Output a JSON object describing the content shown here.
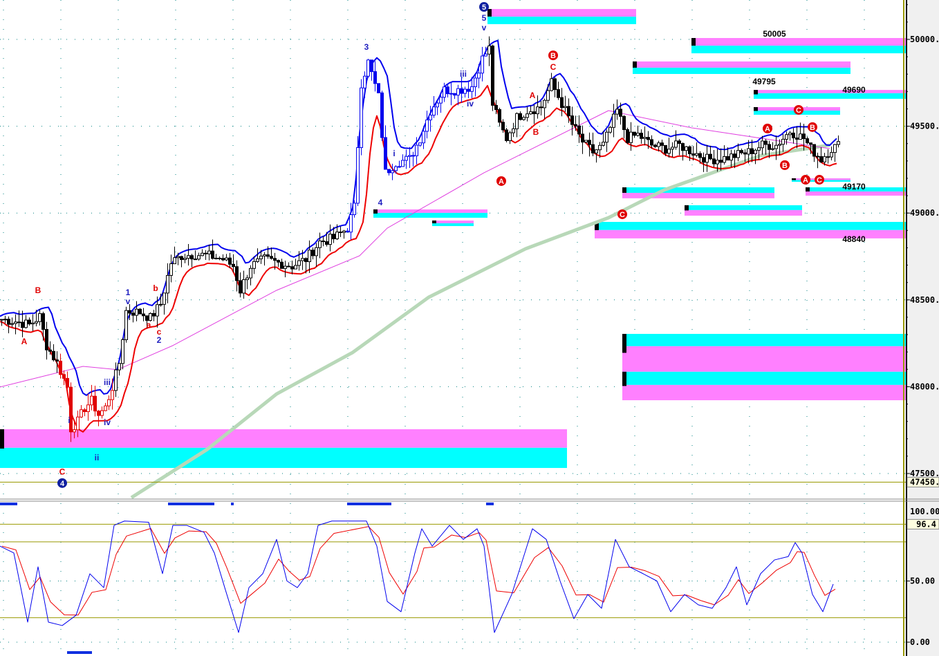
{
  "chart_data": {
    "type": "candlestick",
    "x_unit": "bar",
    "price_axis": {
      "ylim": [
        47410,
        50230
      ],
      "ticks": [
        50000,
        49500,
        49000,
        48500,
        48000,
        47500
      ],
      "tick_labels": [
        "50000.",
        "49500.",
        "49000.",
        "48500.",
        "48000.",
        "47500."
      ],
      "current_label": "47450.",
      "current_value": 47450
    },
    "close": [
      [
        0,
        48388
      ],
      [
        4,
        48376
      ],
      [
        8,
        48356
      ],
      [
        11,
        48404
      ],
      [
        13,
        48237
      ],
      [
        16,
        48137
      ],
      [
        19,
        47998
      ],
      [
        20,
        47759
      ],
      [
        22,
        47799
      ],
      [
        24,
        47879
      ],
      [
        26,
        47918
      ],
      [
        28,
        47839
      ],
      [
        30,
        47879
      ],
      [
        32,
        47998
      ],
      [
        34,
        48137
      ],
      [
        36,
        48436
      ],
      [
        40,
        48428
      ],
      [
        43,
        48396
      ],
      [
        46,
        48476
      ],
      [
        49,
        48714
      ],
      [
        52,
        48754
      ],
      [
        56,
        48762
      ],
      [
        60,
        48754
      ],
      [
        64,
        48734
      ],
      [
        67,
        48695
      ],
      [
        69,
        48555
      ],
      [
        72,
        48695
      ],
      [
        76,
        48734
      ],
      [
        80,
        48714
      ],
      [
        84,
        48695
      ],
      [
        88,
        48734
      ],
      [
        92,
        48834
      ],
      [
        96,
        48854
      ],
      [
        100,
        48913
      ],
      [
        102,
        49033
      ],
      [
        104,
        49749
      ],
      [
        106,
        49869
      ],
      [
        109,
        49670
      ],
      [
        111,
        49232
      ],
      [
        114,
        49292
      ],
      [
        118,
        49311
      ],
      [
        121,
        49431
      ],
      [
        124,
        49590
      ],
      [
        128,
        49709
      ],
      [
        132,
        49709
      ],
      [
        136,
        49729
      ],
      [
        139,
        49889
      ],
      [
        141,
        49948
      ],
      [
        142,
        49630
      ],
      [
        144,
        49510
      ],
      [
        146,
        49431
      ],
      [
        149,
        49550
      ],
      [
        152,
        49590
      ],
      [
        156,
        49610
      ],
      [
        159,
        49749
      ],
      [
        162,
        49630
      ],
      [
        165,
        49510
      ],
      [
        168,
        49411
      ],
      [
        171,
        49351
      ],
      [
        174,
        49391
      ],
      [
        178,
        49590
      ],
      [
        181,
        49431
      ],
      [
        184,
        49451
      ],
      [
        188,
        49391
      ],
      [
        192,
        49371
      ],
      [
        196,
        49391
      ],
      [
        200,
        49351
      ],
      [
        204,
        49311
      ],
      [
        208,
        49311
      ],
      [
        212,
        49331
      ],
      [
        216,
        49351
      ],
      [
        220,
        49391
      ],
      [
        224,
        49391
      ],
      [
        228,
        49471
      ],
      [
        232,
        49431
      ],
      [
        234,
        49371
      ],
      [
        237,
        49311
      ],
      [
        240,
        49371
      ],
      [
        242,
        49391
      ]
    ],
    "ma_magenta": [
      [
        0,
        47998
      ],
      [
        24,
        48117
      ],
      [
        34,
        48098
      ],
      [
        50,
        48237
      ],
      [
        80,
        48555
      ],
      [
        104,
        48754
      ],
      [
        112,
        48913
      ],
      [
        140,
        49232
      ],
      [
        176,
        49590
      ],
      [
        200,
        49491
      ],
      [
        240,
        49371
      ]
    ],
    "ma_green": [
      [
        38,
        47361
      ],
      [
        60,
        47640
      ],
      [
        80,
        47958
      ],
      [
        102,
        48197
      ],
      [
        124,
        48515
      ],
      [
        152,
        48794
      ],
      [
        176,
        48973
      ],
      [
        192,
        49132
      ],
      [
        220,
        49331
      ],
      [
        240,
        49391
      ]
    ],
    "zones": [
      {
        "x": [
          0,
          164
        ],
        "bands": [
          [
            "magenta",
            47755,
            47648
          ],
          [
            "cyan",
            47648,
            47532
          ]
        ]
      },
      {
        "x": [
          141,
          184
        ],
        "bands": [
          [
            "magenta",
            50175,
            50131
          ],
          [
            "cyan",
            50131,
            50088
          ]
        ]
      },
      {
        "x": [
          200,
          262
        ],
        "bands": [
          [
            "magenta",
            50008,
            49964
          ],
          [
            "cyan",
            49964,
            49920
          ]
        ]
      },
      {
        "x": [
          183,
          246
        ],
        "bands": [
          [
            "magenta",
            49873,
            49837
          ],
          [
            "cyan",
            49837,
            49801
          ]
        ]
      },
      {
        "x": [
          218,
          262
        ],
        "bands": [
          [
            "magenta",
            49709,
            49690
          ],
          [
            "cyan",
            49690,
            49658
          ]
        ]
      },
      {
        "x": [
          218,
          243
        ],
        "bands": [
          [
            "magenta",
            49610,
            49590
          ],
          [
            "cyan",
            49590,
            49566
          ]
        ]
      },
      {
        "x": [
          108,
          141
        ],
        "bands": [
          [
            "magenta",
            49021,
            49001
          ],
          [
            "cyan",
            49001,
            48973
          ]
        ]
      },
      {
        "x": [
          125,
          137
        ],
        "bands": [
          [
            "magenta",
            48957,
            48941
          ],
          [
            "cyan",
            48941,
            48925
          ]
        ]
      },
      {
        "x": [
          180,
          224
        ],
        "bands": [
          [
            "cyan",
            49148,
            49116
          ],
          [
            "magenta",
            49116,
            49085
          ]
        ]
      },
      {
        "x": [
          198,
          232
        ],
        "bands": [
          [
            "cyan",
            49045,
            49017
          ],
          [
            "magenta",
            49017,
            48985
          ]
        ]
      },
      {
        "x": [
          172,
          262
        ],
        "bands": [
          [
            "cyan",
            48949,
            48902
          ],
          [
            "magenta",
            48902,
            48854
          ]
        ]
      },
      {
        "x": [
          180,
          262
        ],
        "bands": [
          [
            "cyan",
            48304,
            48233
          ],
          [
            "magenta",
            48233,
            48086
          ]
        ]
      },
      {
        "x": [
          180,
          262
        ],
        "bands": [
          [
            "cyan",
            48086,
            48010
          ],
          [
            "magenta",
            48010,
            47922
          ]
        ]
      },
      {
        "x": [
          229,
          246
        ],
        "bands": [
          [
            "magenta",
            49200,
            49190
          ],
          [
            "cyan",
            49190,
            49180
          ]
        ]
      },
      {
        "x": [
          233,
          262
        ],
        "bands": [
          [
            "cyan",
            49148,
            49124
          ],
          [
            "magenta",
            49124,
            49100
          ]
        ]
      }
    ],
    "wave_labels": [
      {
        "t": "3",
        "x": 106,
        "p": 49956,
        "c": "blue"
      },
      {
        "t": "5",
        "x": 140,
        "p": 50123,
        "c": "blue"
      },
      {
        "t": "v",
        "x": 140,
        "p": 50068,
        "c": "blue"
      },
      {
        "t": "iii",
        "x": 134,
        "p": 49801,
        "c": "blue"
      },
      {
        "t": "iv",
        "x": 136,
        "p": 49630,
        "c": "blue"
      },
      {
        "t": "i",
        "x": 114,
        "p": 49343,
        "c": "blue"
      },
      {
        "t": "4",
        "x": 110,
        "p": 49061,
        "c": "blue"
      },
      {
        "t": "1",
        "x": 37,
        "p": 48543,
        "c": "blue"
      },
      {
        "t": "v",
        "x": 37,
        "p": 48491,
        "c": "blue"
      },
      {
        "t": "2",
        "x": 46,
        "p": 48268,
        "c": "blue"
      },
      {
        "t": "iii",
        "x": 31,
        "p": 48026,
        "c": "blue"
      },
      {
        "t": "iv",
        "x": 31,
        "p": 47795,
        "c": "blue"
      },
      {
        "t": "i",
        "x": 20,
        "p": 47807,
        "c": "blue"
      },
      {
        "t": "ii",
        "x": 28,
        "p": 47592,
        "c": "blue"
      },
      {
        "t": "B",
        "x": 11,
        "p": 48555,
        "c": "red"
      },
      {
        "t": "A",
        "x": 7,
        "p": 48261,
        "c": "red"
      },
      {
        "t": "C",
        "x": 18,
        "p": 47509,
        "c": "red"
      },
      {
        "t": "b",
        "x": 45,
        "p": 48567,
        "c": "red"
      },
      {
        "t": "a",
        "x": 43,
        "p": 48356,
        "c": "red"
      },
      {
        "t": "c",
        "x": 46,
        "p": 48316,
        "c": "red"
      },
      {
        "t": "A",
        "x": 154,
        "p": 49678,
        "c": "red"
      },
      {
        "t": "B",
        "x": 155,
        "p": 49467,
        "c": "red"
      },
      {
        "t": "C",
        "x": 160,
        "p": 49841,
        "c": "red"
      }
    ],
    "circled_labels": [
      {
        "t": "B",
        "x": 160,
        "p": 49908,
        "c": "red"
      },
      {
        "t": "A",
        "x": 145,
        "p": 49184,
        "c": "red"
      },
      {
        "t": "C",
        "x": 180,
        "p": 48993,
        "c": "red"
      },
      {
        "t": "A",
        "x": 222,
        "p": 49487,
        "c": "red"
      },
      {
        "t": "B",
        "x": 227,
        "p": 49276,
        "c": "red"
      },
      {
        "t": "C",
        "x": 231,
        "p": 49594,
        "c": "red"
      },
      {
        "t": "B",
        "x": 235,
        "p": 49495,
        "c": "red"
      },
      {
        "t": "A",
        "x": 233,
        "p": 49192,
        "c": "red"
      },
      {
        "t": "C",
        "x": 237,
        "p": 49192,
        "c": "red"
      },
      {
        "t": "5",
        "x": 140,
        "p": 50187,
        "c": "blue"
      },
      {
        "t": "4",
        "x": 18,
        "p": 47445,
        "c": "blue"
      }
    ],
    "price_labels": [
      {
        "t": "50005",
        "x": 224,
        "p": 50032
      },
      {
        "t": "49795",
        "x": 221,
        "p": 49757
      },
      {
        "t": "49690",
        "x": 247,
        "p": 49709
      },
      {
        "t": "49170",
        "x": 247,
        "p": 49152
      },
      {
        "t": "48840",
        "x": 247,
        "p": 48850
      }
    ],
    "oscillator": {
      "ylim": [
        -5,
        102
      ],
      "ticks": [
        50,
        0
      ],
      "tick_labels": [
        "50.00",
        "0.00"
      ],
      "top_label_partial": "100.00",
      "current_label": "96.4",
      "levels": [
        96.4,
        82,
        20
      ],
      "k": [
        [
          0,
          78.5
        ],
        [
          4,
          72.9
        ],
        [
          8,
          16.4
        ],
        [
          11,
          61.6
        ],
        [
          14,
          16.4
        ],
        [
          18,
          13.6
        ],
        [
          22,
          22
        ],
        [
          26,
          55.9
        ],
        [
          30,
          44.6
        ],
        [
          33,
          95.5
        ],
        [
          36,
          99
        ],
        [
          43,
          98
        ],
        [
          47,
          56
        ],
        [
          50,
          95.5
        ],
        [
          54,
          95.5
        ],
        [
          59,
          89.8
        ],
        [
          62,
          72.9
        ],
        [
          65,
          44.6
        ],
        [
          69,
          7.9
        ],
        [
          72,
          44.6
        ],
        [
          76,
          56
        ],
        [
          80,
          84
        ],
        [
          83,
          50
        ],
        [
          86,
          44.6
        ],
        [
          89,
          56
        ],
        [
          92,
          95.5
        ],
        [
          96,
          99
        ],
        [
          106,
          99
        ],
        [
          109,
          78.5
        ],
        [
          112,
          33.3
        ],
        [
          116,
          24.9
        ],
        [
          120,
          72.9
        ],
        [
          122,
          92.7
        ],
        [
          125,
          78.5
        ],
        [
          130,
          95.5
        ],
        [
          134,
          84
        ],
        [
          138,
          92.7
        ],
        [
          140,
          78.5
        ],
        [
          143,
          7.9
        ],
        [
          148,
          39
        ],
        [
          154,
          92.7
        ],
        [
          158,
          84
        ],
        [
          162,
          50
        ],
        [
          166,
          19.2
        ],
        [
          170,
          39
        ],
        [
          174,
          27.7
        ],
        [
          178,
          84
        ],
        [
          182,
          61.6
        ],
        [
          186,
          56
        ],
        [
          190,
          50
        ],
        [
          194,
          24.9
        ],
        [
          198,
          39
        ],
        [
          202,
          30.5
        ],
        [
          206,
          27.7
        ],
        [
          210,
          44.6
        ],
        [
          213,
          61.6
        ],
        [
          216,
          30.5
        ],
        [
          220,
          56
        ],
        [
          224,
          67.2
        ],
        [
          228,
          70
        ],
        [
          230,
          81.4
        ],
        [
          232,
          72.9
        ],
        [
          235,
          39
        ],
        [
          238,
          24.9
        ],
        [
          241,
          47.5
        ]
      ]
    },
    "colors": {
      "up_line": "#0000ee",
      "down_line": "#ee0000",
      "ma_magenta": "#e040e0",
      "ma_green": "#b8d8b8",
      "cyan": "#00ffff",
      "magenta": "#ff80ff",
      "level": "#999900",
      "grid": "#008080"
    }
  }
}
